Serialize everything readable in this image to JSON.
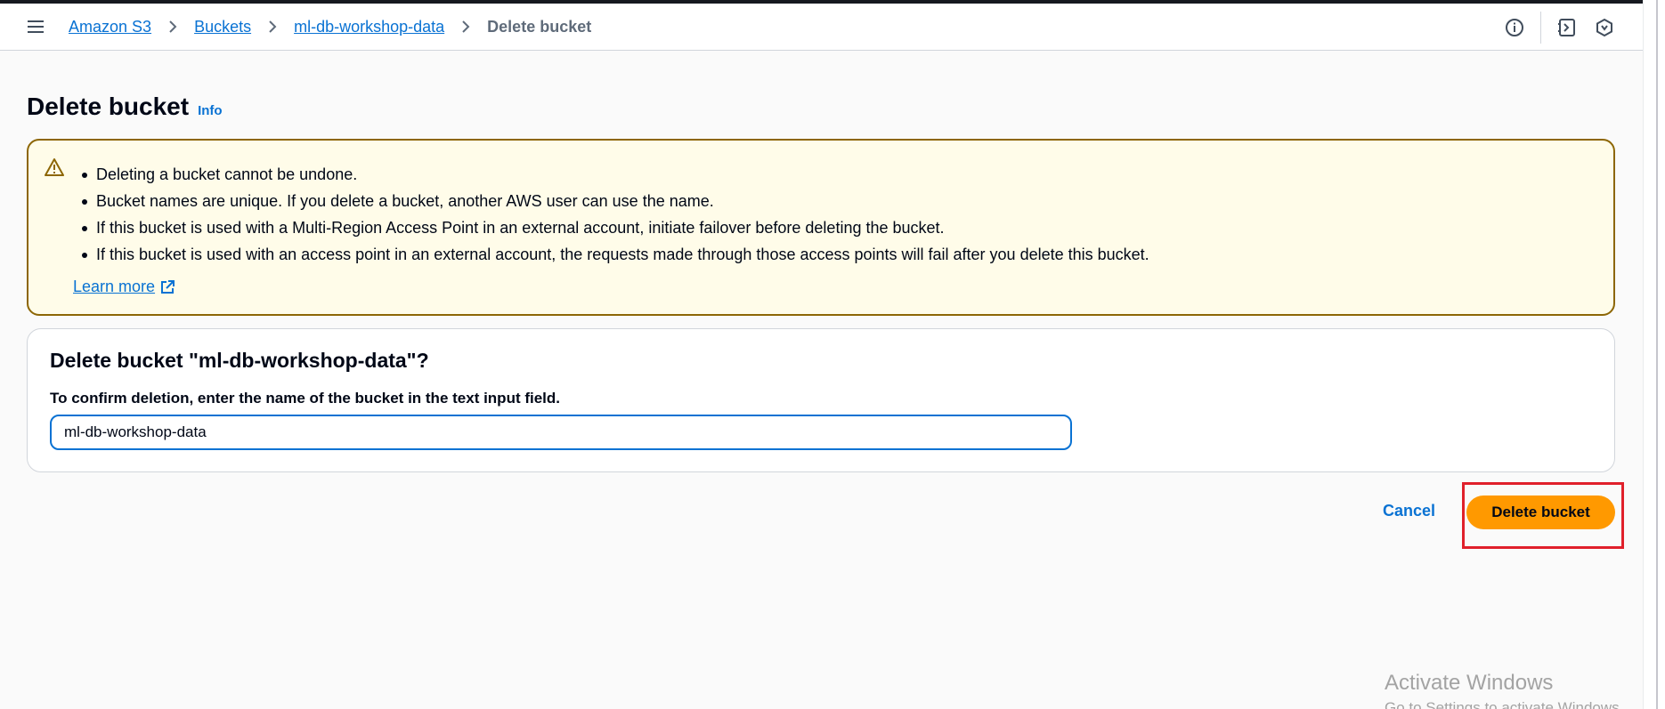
{
  "header": {
    "breadcrumbs": [
      {
        "label": "Amazon S3"
      },
      {
        "label": "Buckets"
      },
      {
        "label": "ml-db-workshop-data"
      }
    ],
    "current": "Delete bucket",
    "icons": [
      "info-icon",
      "notifications-panel-icon",
      "settings-hex-icon"
    ]
  },
  "page": {
    "title": "Delete bucket",
    "info_label": "Info"
  },
  "alert": {
    "items": [
      "Deleting a bucket cannot be undone.",
      "Bucket names are unique. If you delete a bucket, another AWS user can use the name.",
      "If this bucket is used with a Multi-Region Access Point in an external account, initiate failover before deleting the bucket.",
      "If this bucket is used with an access point in an external account, the requests made through those access points will fail after you delete this bucket."
    ],
    "learn_more": "Learn more",
    "color": "#8d6605"
  },
  "confirm": {
    "title": "Delete bucket \"ml-db-workshop-data\"?",
    "label": "To confirm deletion, enter the name of the bucket in the text input field.",
    "input_value": "ml-db-workshop-data"
  },
  "actions": {
    "cancel": "Cancel",
    "delete": "Delete bucket",
    "delete_color": "#ff9900"
  },
  "watermark": {
    "title": "Activate Windows",
    "subtitle": "Go to Settings to activate Windows."
  }
}
